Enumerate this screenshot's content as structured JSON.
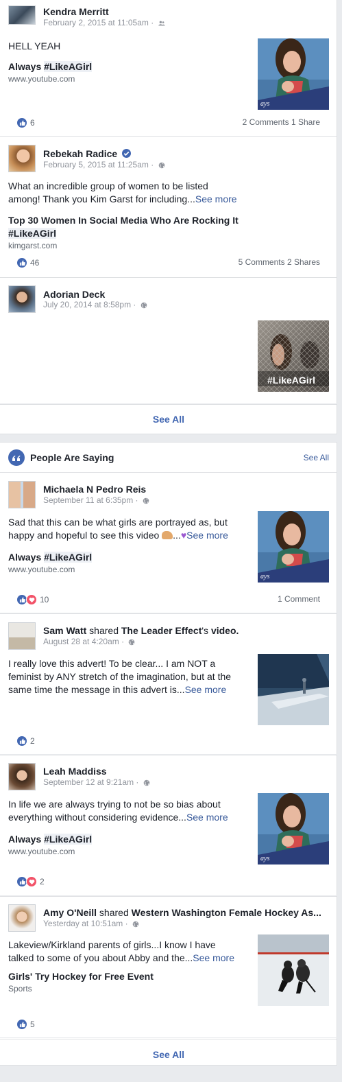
{
  "top_posts": [
    {
      "name": "Kendra Merritt",
      "date": "February 2, 2015 at 11:05am",
      "text": "HELL YEAH",
      "link_title_prefix": "Always ",
      "link_tag": "#LikeAGirl",
      "link_domain": "www.youtube.com",
      "likes": "6",
      "comments": "2 Comments",
      "shares": "1 Share"
    },
    {
      "name": "Rebekah Radice",
      "date": "February 5, 2015 at 11:25am",
      "text_line1": "What an incredible group of women to be listed",
      "text_line2": "among! Thank you Kim Garst for including...",
      "see_more": "See more",
      "link_title_line1": "Top 30 Women In Social Media Who Are Rocking It",
      "link_tag": "#LikeAGirl",
      "link_domain": "kimgarst.com",
      "likes": "46",
      "comments": "5 Comments",
      "shares": "2 Shares"
    },
    {
      "name": "Adorian Deck",
      "date": "July 20, 2014 at 8:58pm",
      "thumb_text": "#LikeAGirl"
    }
  ],
  "see_all_1": "See All",
  "section": {
    "title": "People Are Saying",
    "see_all": "See All"
  },
  "people_posts": [
    {
      "name": "Michaela N Pedro Reis",
      "date": "September 11 at 6:35pm",
      "text_line1": "Sad that this can be what girls are portrayed as, but",
      "text_line2": "happy and hopeful to see this video",
      "see_more": "See more",
      "link_title_prefix": "Always ",
      "link_tag": "#LikeAGirl",
      "link_domain": "www.youtube.com",
      "likes": "10",
      "comments": "1 Comment"
    },
    {
      "name": "Sam Watt",
      "shared_word": "shared",
      "page": "The Leader Effect",
      "suffix": "'s",
      "object": "video.",
      "date": "August 28 at 4:20am",
      "text_line1": "I really love this advert! To be clear... I am NOT a",
      "text_line2": "feminist by ANY stretch of the imagination, but at the",
      "text_line3": "same time the message in this advert is...",
      "see_more": "See more",
      "likes": "2"
    },
    {
      "name": "Leah Maddiss",
      "date": "September 12 at 9:21am",
      "text_line1": "In life we are always trying to not be so bias about",
      "text_line2": "everything without considering evidence...",
      "see_more": "See more",
      "link_title_prefix": "Always ",
      "link_tag": "#LikeAGirl",
      "link_domain": "www.youtube.com",
      "likes": "2"
    },
    {
      "name": "Amy O'Neill",
      "shared_word": "shared",
      "page": "Western Washington Female Hockey As...",
      "date": "Yesterday at 10:51am",
      "text_line1": "Lakeview/Kirkland parents of girls...I know I have",
      "text_line2": "talked to some of you about Abby and the...",
      "see_more": "See more",
      "link_title": "Girls' Try Hockey for Free Event",
      "link_domain": "Sports",
      "likes": "5"
    }
  ],
  "see_all_2": "See All",
  "colors": {
    "brand_blue": "#4267b2",
    "link_blue": "#365899",
    "love_red": "#f25268"
  }
}
